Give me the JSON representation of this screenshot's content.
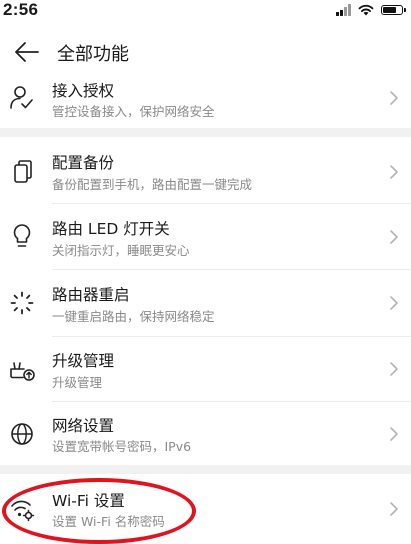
{
  "status_bar": {
    "time": "2:56"
  },
  "header": {
    "title": "全部功能"
  },
  "items": [
    {
      "title": "接入授权",
      "subtitle": "管控设备接入，保护网络安全"
    },
    {
      "title": "配置备份",
      "subtitle": "备份配置到手机，路由配置一键完成"
    },
    {
      "title": "路由 LED 灯开关",
      "subtitle": "关闭指示灯，睡眠更安心"
    },
    {
      "title": "路由器重启",
      "subtitle": "一键重启路由，保持网络稳定"
    },
    {
      "title": "升级管理",
      "subtitle": "升级管理"
    },
    {
      "title": "网络设置",
      "subtitle": "设置宽带帐号密码，IPv6"
    },
    {
      "title": "Wi-Fi 设置",
      "subtitle": "设置 Wi-Fi 名称密码"
    }
  ],
  "annotation": {
    "color": "#e0141e"
  }
}
